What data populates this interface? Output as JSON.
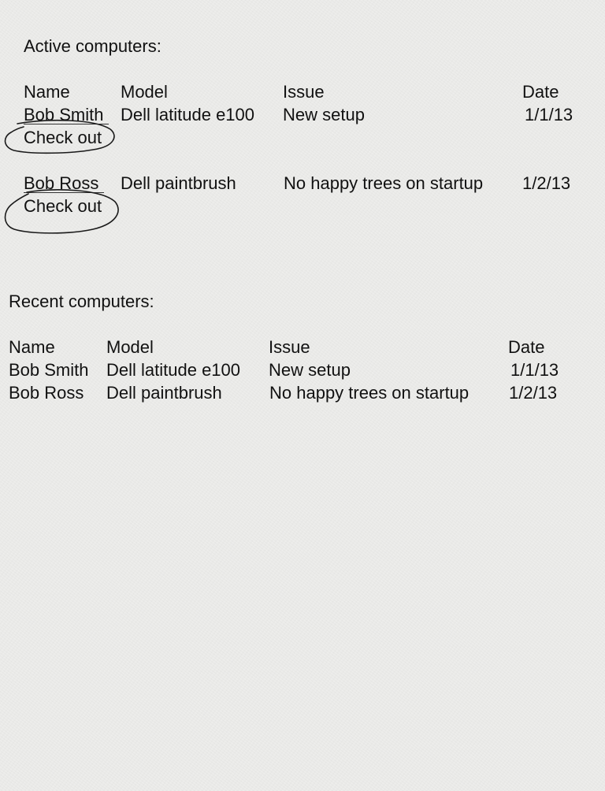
{
  "active": {
    "heading": "Active computers:",
    "headers": {
      "name": "Name",
      "model": "Model",
      "issue": "Issue",
      "date": "Date"
    },
    "rows": [
      {
        "name": "Bob Smith",
        "model": "Dell latitude e100",
        "issue": "New setup",
        "date": "1/1/13",
        "action": "Check out"
      },
      {
        "name": "Bob Ross",
        "model": "Dell paintbrush",
        "issue": "No happy trees on startup",
        "date": "1/2/13",
        "action": "Check out"
      }
    ]
  },
  "recent": {
    "heading": "Recent computers:",
    "headers": {
      "name": "Name",
      "model": "Model",
      "issue": "Issue",
      "date": "Date"
    },
    "rows": [
      {
        "name": "Bob Smith",
        "model": "Dell latitude e100",
        "issue": "New setup",
        "date": "1/1/13"
      },
      {
        "name": "Bob Ross",
        "model": "Dell paintbrush",
        "issue": "No happy trees on startup",
        "date": "1/2/13"
      }
    ]
  }
}
